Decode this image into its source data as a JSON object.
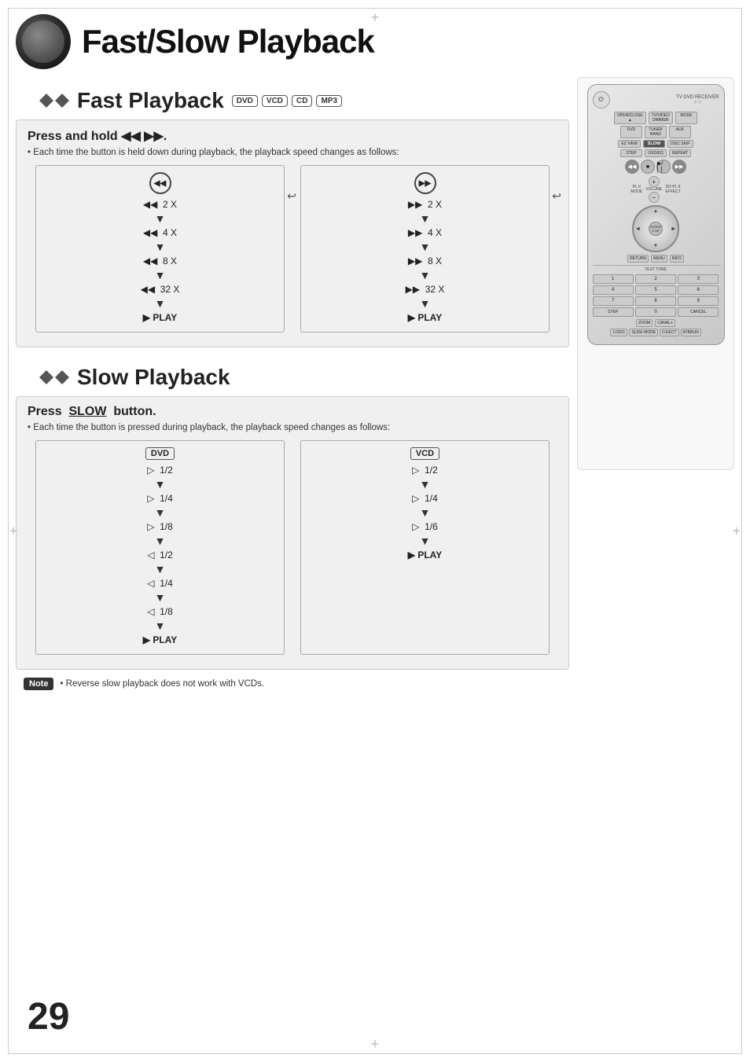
{
  "page": {
    "title": "Fast/Slow Playback",
    "page_number": "29"
  },
  "header": {
    "title": "Fast/Slow Playback"
  },
  "fast_playback": {
    "section_title": "Fast Playback",
    "badges": [
      "DVD",
      "VCD",
      "CD",
      "MP3"
    ],
    "instruction_title": "Press and hold ◀◀ ▶▶.",
    "instruction_sub": "• Each time the button is held down during playback, the playback speed changes as follows:",
    "rewind_col": {
      "header": "◀◀",
      "steps": [
        "◀◀  2 X",
        "◀◀  4 X",
        "◀◀  8 X",
        "◀◀  32 X",
        "▶  PLAY"
      ]
    },
    "forward_col": {
      "header": "▶▶",
      "steps": [
        "▶▶  2 X",
        "▶▶  4 X",
        "▶▶  8 X",
        "▶▶  32 X",
        "▶  PLAY"
      ]
    }
  },
  "slow_playback": {
    "section_title": "Slow Playback",
    "instruction_title": "Press  SLOW  button.",
    "instruction_sub": "• Each time the button is pressed during playback, the playback speed changes as follows:",
    "dvd_col": {
      "label": "DVD",
      "steps": [
        "▷  1/2",
        "▷  1/4",
        "▷  1/8",
        "◁  1/2",
        "◁  1/4",
        "◁  1/8",
        "▶  PLAY"
      ]
    },
    "vcd_col": {
      "label": "VCD",
      "steps": [
        "▷  1/2",
        "▷  1/4",
        "▷  1/6",
        "▶  PLAY"
      ]
    }
  },
  "note": {
    "label": "Note",
    "text": "• Reverse slow playback does not work with VCDs."
  },
  "remote": {
    "rows": [
      [
        "OPEN/CLOSE",
        "TV/VIDEO",
        "MODE"
      ],
      [
        "DVD",
        "TUNER",
        "AUX"
      ],
      [
        "EZ VIEW",
        "SLOW",
        "DISC SKIP"
      ],
      [
        "STEP",
        "OSD/EQ",
        "REPEAT"
      ]
    ],
    "transport": [
      "◀◀",
      "■",
      "▶/▏▏",
      "▶▶"
    ],
    "numpad": [
      "1",
      "2",
      "3",
      "4",
      "5",
      "6",
      "7",
      "8",
      "9",
      "STEP",
      "0",
      "CANCEL"
    ],
    "bottom": [
      "LOGO",
      "SLIDE MODE",
      "D.EECT",
      "ATBRUN"
    ]
  }
}
